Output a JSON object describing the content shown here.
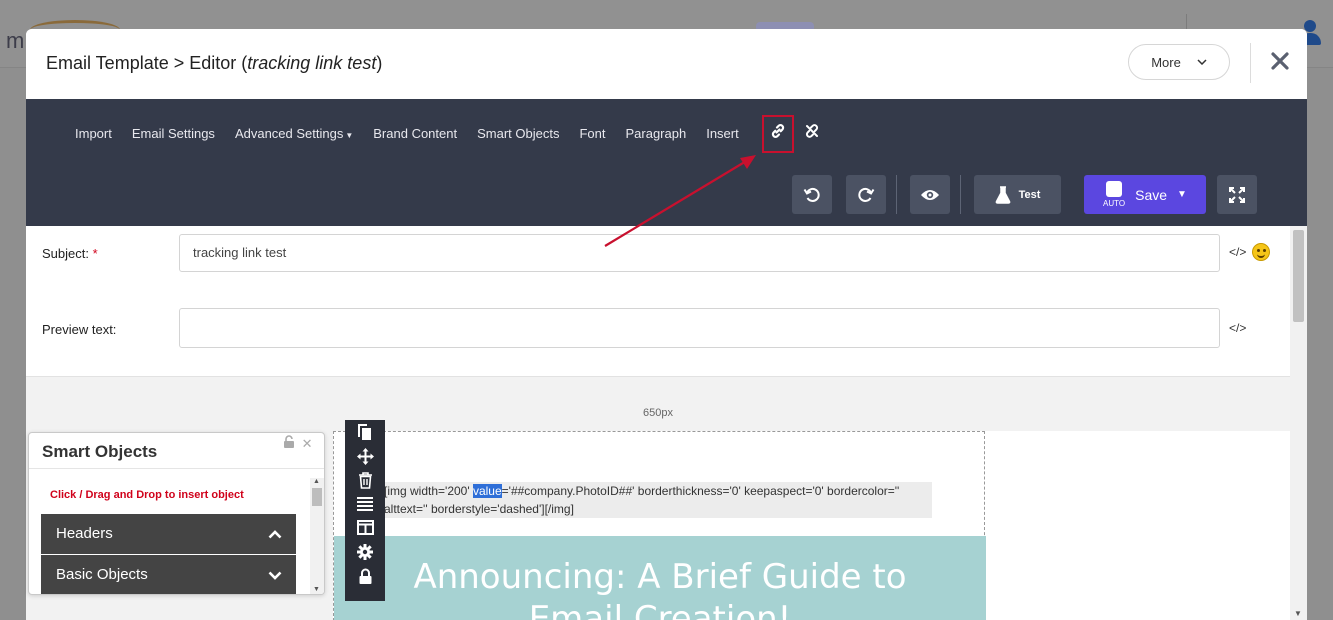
{
  "background": {
    "logo_text": "m"
  },
  "modal": {
    "title_prefix": "Email Template > Editor (",
    "title_name": "tracking link test",
    "title_suffix": ")",
    "more_label": "More",
    "close_glyph": "✕"
  },
  "toolbar": {
    "menu": [
      {
        "label": "Import"
      },
      {
        "label": "Email Settings"
      },
      {
        "label": "Advanced Settings"
      },
      {
        "label": "Brand Content"
      },
      {
        "label": "Smart Objects"
      },
      {
        "label": "Font"
      },
      {
        "label": "Paragraph"
      },
      {
        "label": "Insert"
      }
    ],
    "test_label": "Test",
    "save_label": "Save",
    "auto_label": "AUTO"
  },
  "form": {
    "subject_label": "Subject:",
    "required_mark": "*",
    "subject_value": "tracking link test",
    "preview_label": "Preview text:",
    "preview_value": "",
    "code_glyph": "</>"
  },
  "canvas": {
    "width_label": "650px",
    "img_code_before": "[img width='200' ",
    "img_code_selected": "value",
    "img_code_after_line1": "='##company.PhotoID##' borderthickness='0' keepaspect='0' bordercolor=''",
    "img_code_line2": "alttext='' borderstyle='dashed'][/img]",
    "banner_text_line1": "Announcing: A Brief Guide to",
    "banner_text_line2": "Email Creation!"
  },
  "smart_objects_panel": {
    "title": "Smart Objects",
    "hint": "Click / Drag and Drop to insert object",
    "sections": [
      {
        "label": "Headers",
        "state": "expanded"
      },
      {
        "label": "Basic Objects",
        "state": "collapsed"
      }
    ]
  },
  "colors": {
    "toolbar_bg": "#343a4a",
    "save_button": "#5b47e0",
    "highlight": "#c8102e",
    "banner": "#a6d2d2"
  }
}
